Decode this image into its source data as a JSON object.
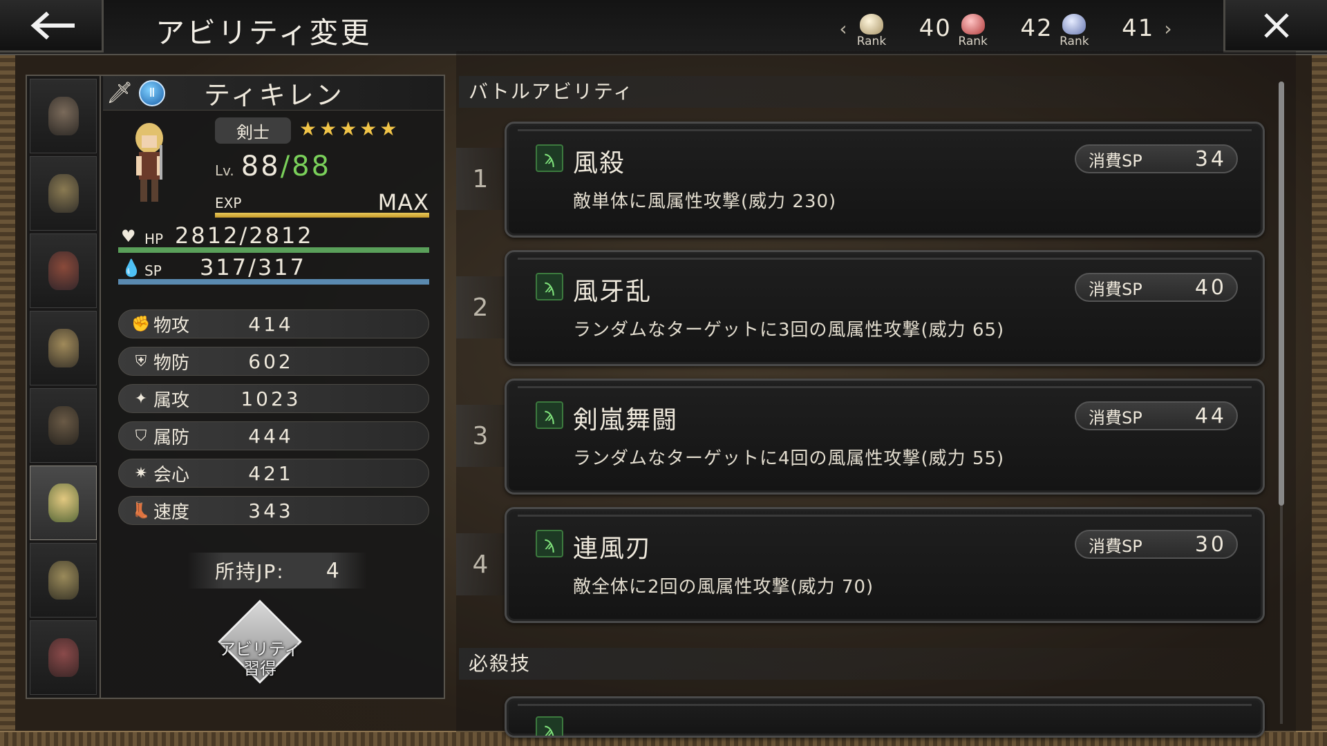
{
  "header": {
    "title": "アビリティ変更",
    "ranks": [
      {
        "label": "Rank",
        "value": "40",
        "color": "#e8dcc0"
      },
      {
        "label": "Rank",
        "value": "42",
        "color": "#d86a6a"
      },
      {
        "label": "Rank",
        "value": "41",
        "color": "#b9c4e8"
      }
    ]
  },
  "character": {
    "name": "ティキレン",
    "job": "剣士",
    "stars": "★★★★★",
    "lv_label": "Lv.",
    "lv_current": "88",
    "lv_max": "/88",
    "exp_label": "EXP",
    "exp_value": "MAX",
    "exp_progress": 1.0,
    "hp_label": "HP",
    "hp": "2812/2812",
    "sp_label": "SP",
    "sp": "317/317",
    "stats": [
      {
        "label": "物攻",
        "value": "414",
        "icon": "attack-icon"
      },
      {
        "label": "物防",
        "value": "602",
        "icon": "defense-icon"
      },
      {
        "label": "属攻",
        "value": "1023",
        "icon": "elemental-attack-icon"
      },
      {
        "label": "属防",
        "value": "444",
        "icon": "elemental-defense-icon"
      },
      {
        "label": "会心",
        "value": "421",
        "icon": "critical-icon"
      },
      {
        "label": "速度",
        "value": "343",
        "icon": "speed-icon"
      }
    ],
    "jp_label": "所持JP:",
    "jp_value": "4",
    "acquire_label_1": "アビリティ",
    "acquire_label_2": "習得"
  },
  "battle_abilities": {
    "title": "バトルアビリティ",
    "items": [
      {
        "slot": "1",
        "name": "風殺",
        "sp_label": "消費SP",
        "sp": "34",
        "desc": "敵単体に風属性攻撃(威力 230)"
      },
      {
        "slot": "2",
        "name": "風牙乱",
        "sp_label": "消費SP",
        "sp": "40",
        "desc": "ランダムなターゲットに3回の風属性攻撃(威力 65)"
      },
      {
        "slot": "3",
        "name": "剣嵐舞闘",
        "sp_label": "消費SP",
        "sp": "44",
        "desc": "ランダムなターゲットに4回の風属性攻撃(威力 55)"
      },
      {
        "slot": "4",
        "name": "連風刃",
        "sp_label": "消費SP",
        "sp": "30",
        "desc": "敵全体に2回の風属性攻撃(威力 70)"
      }
    ]
  },
  "special": {
    "title": "必殺技"
  }
}
